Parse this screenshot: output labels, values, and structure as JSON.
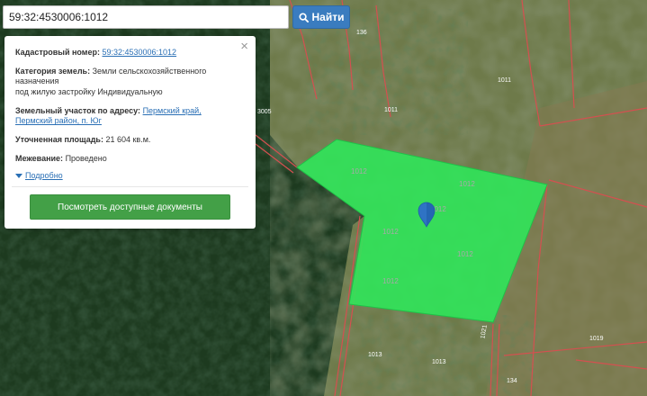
{
  "search": {
    "value": "59:32:4530006:1012",
    "button_label": "Найти"
  },
  "map": {
    "parcel_fill": "#2ee85a",
    "boundary_color": "#d45050",
    "parcel_labels": [
      "1012",
      "1012",
      "1012",
      "1012",
      "1012",
      "1012"
    ],
    "other_labels": [
      "136",
      "1011",
      "1011",
      "3005",
      "1013",
      "1013",
      "1021",
      "1019",
      "134"
    ]
  },
  "info": {
    "cadastral_label": "Кадастровый номер:",
    "cadastral_value": "59:32:4530006:1012",
    "category_label": "Категория земель:",
    "category_lines": [
      "Земли сельскохозяйственного",
      "назначения",
      "под жилую застройку Индивидуальную"
    ],
    "address_label": "Земельный участок по адресу:",
    "address_lines": [
      "Пермский край,",
      "Пермский район, п. Юг"
    ],
    "area_label": "Уточненная площадь:",
    "area_value": "21 604 кв.м.",
    "survey_label": "Межевание:",
    "survey_value": "Проведено",
    "more_label": "Подробно",
    "docs_button": "Посмотреть доступные документы"
  }
}
